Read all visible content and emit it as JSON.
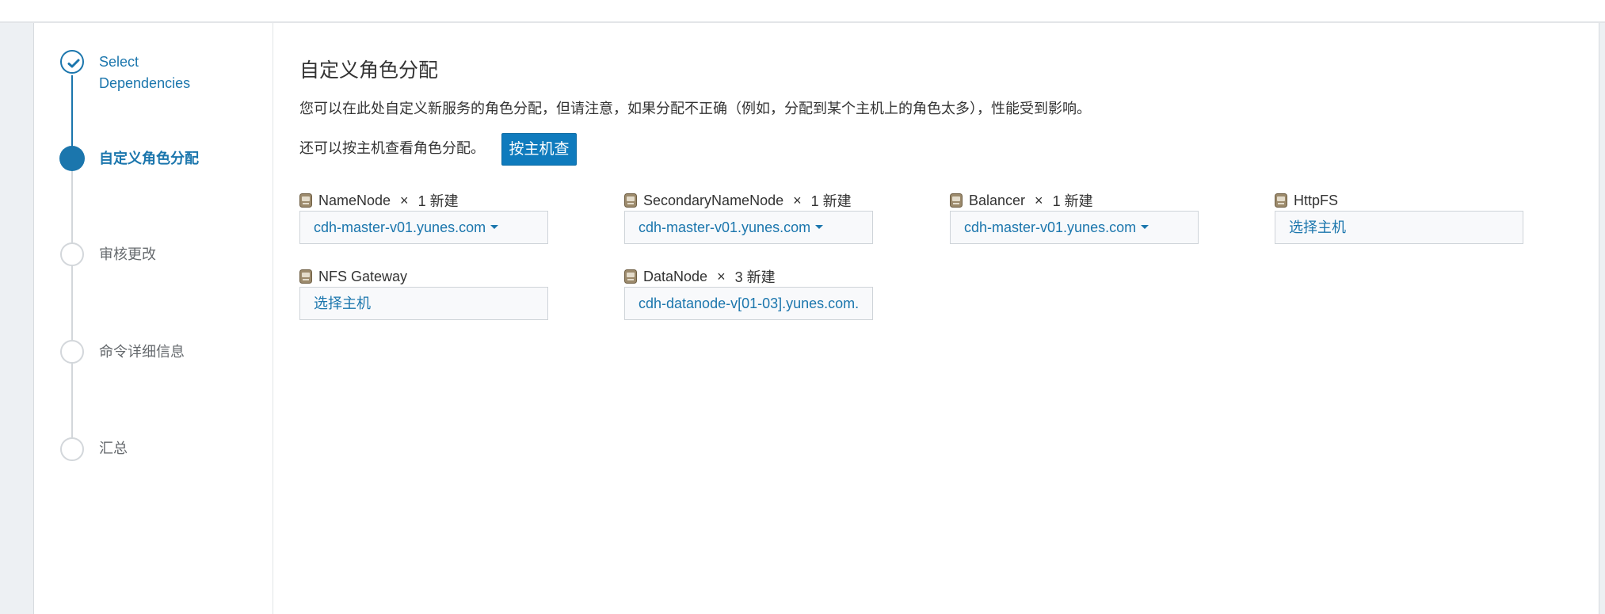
{
  "wizard": {
    "steps": [
      {
        "label_line1": "Select",
        "label_line2": "Dependencies",
        "state": "done"
      },
      {
        "label": "自定义角色分配",
        "state": "current"
      },
      {
        "label": "审核更改",
        "state": "todo"
      },
      {
        "label": "命令详细信息",
        "state": "todo"
      },
      {
        "label": "汇总",
        "state": "todo"
      }
    ]
  },
  "main": {
    "title": "自定义角色分配",
    "description": "您可以在此处自定义新服务的角色分配，但请注意，如果分配不正确（例如，分配到某个主机上的角色太多），性能受到影响。",
    "byhost_text": "还可以按主机查看角色分配。",
    "byhost_button": "按主机查看"
  },
  "roles": [
    {
      "name": "NameNode",
      "times": "×",
      "count": "1 新建",
      "host": "cdh-master-v01.yunes.com",
      "dropdown": true
    },
    {
      "name": "SecondaryNameNode",
      "times": "×",
      "count": "1 新建",
      "host": "cdh-master-v01.yunes.com",
      "dropdown": true
    },
    {
      "name": "Balancer",
      "times": "×",
      "count": "1 新建",
      "host": "cdh-master-v01.yunes.com",
      "dropdown": true
    },
    {
      "name": "HttpFS",
      "times": "",
      "count": "",
      "host": "选择主机",
      "dropdown": false
    },
    {
      "name": "NFS Gateway",
      "times": "",
      "count": "",
      "host": "选择主机",
      "dropdown": false
    },
    {
      "name": "DataNode",
      "times": "×",
      "count": "3 新建",
      "host": "cdh-datanode-v[01-03].yunes.com.",
      "dropdown": false
    }
  ],
  "icons": {
    "step_done": "check-icon",
    "role": "role-icon",
    "dropdown": "caret-down-icon"
  },
  "colors": {
    "accent": "#1b76ad",
    "button": "#0f7bbd"
  }
}
